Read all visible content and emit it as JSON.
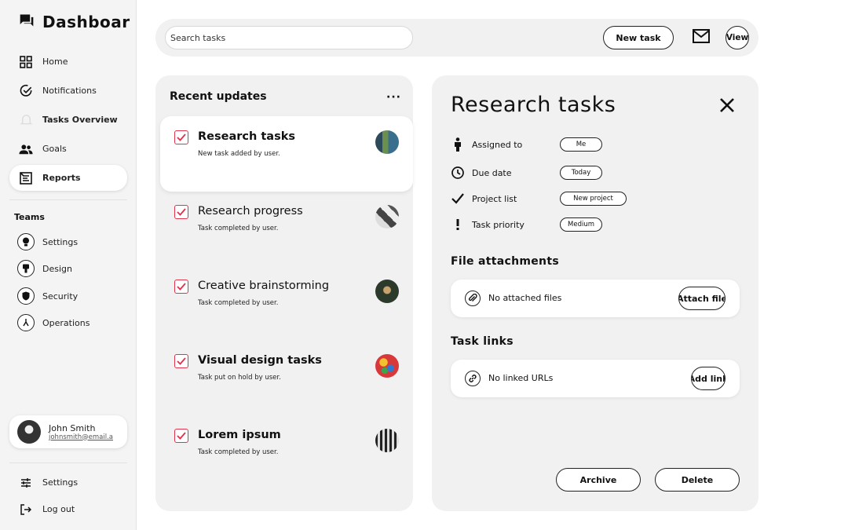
{
  "sidebar": {
    "brand": "Dashboar",
    "nav": [
      {
        "label": "Home",
        "icon": "grid-icon"
      },
      {
        "label": "Notifications",
        "icon": "check-circle-icon"
      },
      {
        "label": "Tasks Overview",
        "icon": "bell-icon"
      },
      {
        "label": "Goals",
        "icon": "users-icon"
      },
      {
        "label": "Reports",
        "icon": "report-icon"
      }
    ],
    "teams_title": "Teams",
    "teams": [
      {
        "label": "Settings",
        "icon": "bulb-icon"
      },
      {
        "label": "Design",
        "icon": "brush-icon"
      },
      {
        "label": "Security",
        "icon": "shield-icon"
      },
      {
        "label": "Operations",
        "icon": "ops-icon"
      }
    ],
    "user": {
      "name": "John Smith",
      "email": "johnsmith@email.a"
    },
    "footer": [
      {
        "label": "Settings",
        "icon": "sliders-icon"
      },
      {
        "label": "Log out",
        "icon": "logout-icon"
      }
    ]
  },
  "topbar": {
    "search_placeholder": "Search tasks",
    "new_task_label": "New task",
    "view_label": "View"
  },
  "updates": {
    "title": "Recent updates",
    "more": "···",
    "items": [
      {
        "title": "Research tasks",
        "sub": "New task added by user."
      },
      {
        "title": "Research progress",
        "sub": "Task completed by user."
      },
      {
        "title": "Creative brainstorming",
        "sub": "Task completed by user."
      },
      {
        "title": "Visual design tasks",
        "sub": "Task put on hold by user."
      },
      {
        "title": "Lorem ipsum",
        "sub": "Task completed by user."
      }
    ]
  },
  "detail": {
    "title": "Research tasks",
    "props": [
      {
        "label": "Assigned to",
        "value": "Me",
        "icon": "person-icon"
      },
      {
        "label": "Due date",
        "value": "Today",
        "icon": "clock-icon"
      },
      {
        "label": "Project list",
        "value": "New project",
        "icon": "check-icon"
      },
      {
        "label": "Task priority",
        "value": "Medium",
        "icon": "exclamation-icon"
      }
    ],
    "attachments_title": "File attachments",
    "attachments_text": "No attached files",
    "attach_btn": "Attach file",
    "links_title": "Task links",
    "links_text": "No linked URLs",
    "add_link_btn": "Add link",
    "archive_label": "Archive",
    "delete_label": "Delete"
  },
  "colors": {
    "accent_check": "#e0334d",
    "panel": "#f1f1f1"
  }
}
